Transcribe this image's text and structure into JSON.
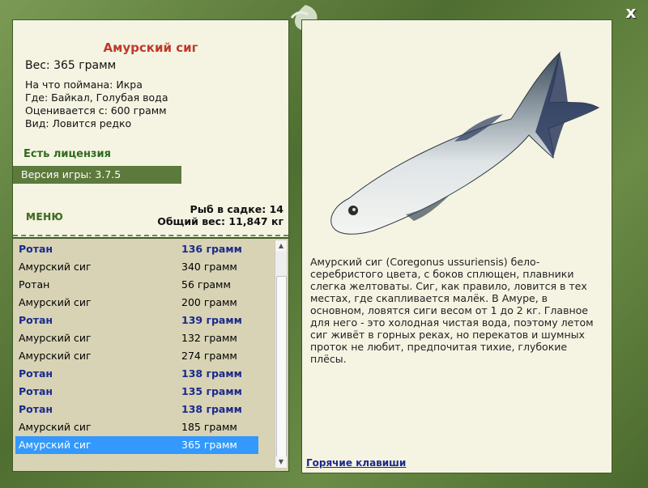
{
  "window": {
    "close_label": "x"
  },
  "fish": {
    "title": "Амурский сиг",
    "weight": "Вес: 365 грамм",
    "bait": "На что поймана: Икра",
    "place": "Где: Байкал, Голубая вода",
    "price": "Оценивается с: 600 грамм",
    "rarity": "Вид: Ловится редко",
    "description": "Амурский сиг (Coregonus ussuriensis) бело-серебристого цвета, с боков сплющен, плавники слегка желтоваты. Сиг, как правило, ловится в тех местах, где скапливается малёк. В Амуре, в основном, ловятся сиги весом от 1 до 2 кг. Главное для него - это холодная чистая вода, поэтому летом сиг живёт в горных реках, но перекатов и шумных проток не любит, предпочитая тихие, глубокие плёсы."
  },
  "license": "Есть лицензия",
  "version": "Версия игры: 3.7.5",
  "menu_label": "МЕНЮ",
  "stats": {
    "count": "Рыб в садке: 14",
    "total_weight": "Общий вес: 11,847 кг"
  },
  "catch_list": [
    {
      "name": "Ротан",
      "weight": "136 грамм",
      "bold": true,
      "selected": false
    },
    {
      "name": "Амурский сиг",
      "weight": "340 грамм",
      "bold": false,
      "selected": false
    },
    {
      "name": "Ротан",
      "weight": "56 грамм",
      "bold": false,
      "selected": false
    },
    {
      "name": "Амурский сиг",
      "weight": "200 грамм",
      "bold": false,
      "selected": false
    },
    {
      "name": "Ротан",
      "weight": "139 грамм",
      "bold": true,
      "selected": false
    },
    {
      "name": "Амурский сиг",
      "weight": "132 грамм",
      "bold": false,
      "selected": false
    },
    {
      "name": "Амурский сиг",
      "weight": "274 грамм",
      "bold": false,
      "selected": false
    },
    {
      "name": "Ротан",
      "weight": "138 грамм",
      "bold": true,
      "selected": false
    },
    {
      "name": "Ротан",
      "weight": "135 грамм",
      "bold": true,
      "selected": false
    },
    {
      "name": "Ротан",
      "weight": "138 грамм",
      "bold": true,
      "selected": false
    },
    {
      "name": "Амурский сиг",
      "weight": "185 грамм",
      "bold": false,
      "selected": false
    },
    {
      "name": "Амурский сиг",
      "weight": "365 грамм",
      "bold": false,
      "selected": true
    }
  ],
  "hotkeys_label": "Горячие клавиши",
  "colors": {
    "frame": "#5b7a3c",
    "panel": "#f5f3e2",
    "title": "#c0392b",
    "bold_row": "#1a2a8c",
    "selection": "#3399ff",
    "license": "#2f6b1f"
  }
}
